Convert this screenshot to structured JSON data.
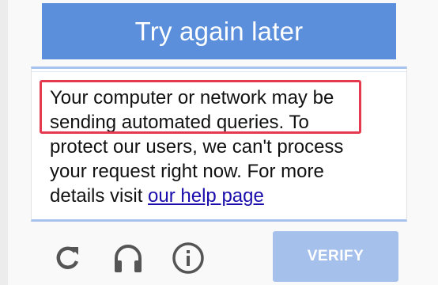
{
  "header": {
    "title": "Try again later"
  },
  "message": {
    "line1": "Your computer or network may be",
    "line2": "sending automated queries.",
    "line2_rest": " To",
    "line3": "protect our users, we can't process",
    "line4": "your request right now. For more",
    "line5_prefix": "details visit ",
    "help_link": "our help page"
  },
  "controls": {
    "reload_icon": "reload-icon",
    "audio_icon": "headphones-icon",
    "info_icon": "info-icon",
    "verify_label": "VERIFY"
  },
  "colors": {
    "header_bg": "#5b8fdb",
    "verify_bg": "#a6c0ec",
    "highlight": "#e53950",
    "link": "#1a0dab"
  }
}
